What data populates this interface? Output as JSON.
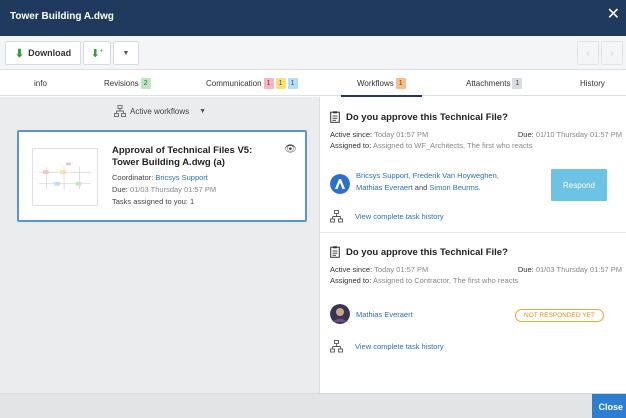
{
  "window": {
    "title": "Tower Building A.dwg",
    "close_icon": "close-icon"
  },
  "toolbar": {
    "download_label": "Download",
    "download_icon": "download-arrow-icon",
    "action_icon": "workflow-arrow-icon",
    "caret_icon": "chevron-down-icon",
    "prev_icon": "chevron-left-icon",
    "next_icon": "chevron-right-icon"
  },
  "tabs": [
    {
      "label": "info"
    },
    {
      "label": "Revisions",
      "badges": [
        "2"
      ]
    },
    {
      "label": "Communication",
      "badges": [
        "1",
        "1",
        "1"
      ]
    },
    {
      "label": "Workflows",
      "badges": [
        "1"
      ]
    },
    {
      "label": "Attachments",
      "badges": [
        "1"
      ]
    },
    {
      "label": "History"
    }
  ],
  "filter": {
    "label": "Active workflows"
  },
  "card": {
    "title": "Approval of Technical Files V5: Tower Building A.dwg (a)",
    "coordinator_label": "Coordinator:",
    "coordinator": "Bricsys Support",
    "due_label": "Due:",
    "due": "01/03 Thursday 01:57 PM",
    "tasks_label": "Tasks assigned to you:",
    "tasks_count": "1"
  },
  "tasks": [
    {
      "question": "Do you approve this Technical File?",
      "active_label": "Active since:",
      "active": "Today 01:57 PM",
      "due_label": "Due:",
      "due": "01/10 Thursday 01:57 PM",
      "assigned_label": "Assigned to:",
      "assigned": "Assigned to WF_Architects, The first who reacts",
      "people_line1": "Bricsys Support,  Frederik Van Hoyweghen,",
      "people_a": "Mathias Everaert",
      "people_and": "and",
      "people_b": "Simon Beurms.",
      "respond_label": "Respond",
      "history_label": "View complete task history"
    },
    {
      "question": "Do you approve this Technical File?",
      "active_label": "Active since:",
      "active": "Today 01:57 PM",
      "due_label": "Due:",
      "due": "01/03 Thursday 01:57 PM",
      "assigned_label": "Assigned to:",
      "assigned": "Assigned to Contractor, The first who reacts",
      "person": "Mathias Everaert",
      "status": "NOT RESPONDED YET",
      "history_label": "View complete task history"
    }
  ],
  "footer": {
    "close_label": "Close"
  }
}
